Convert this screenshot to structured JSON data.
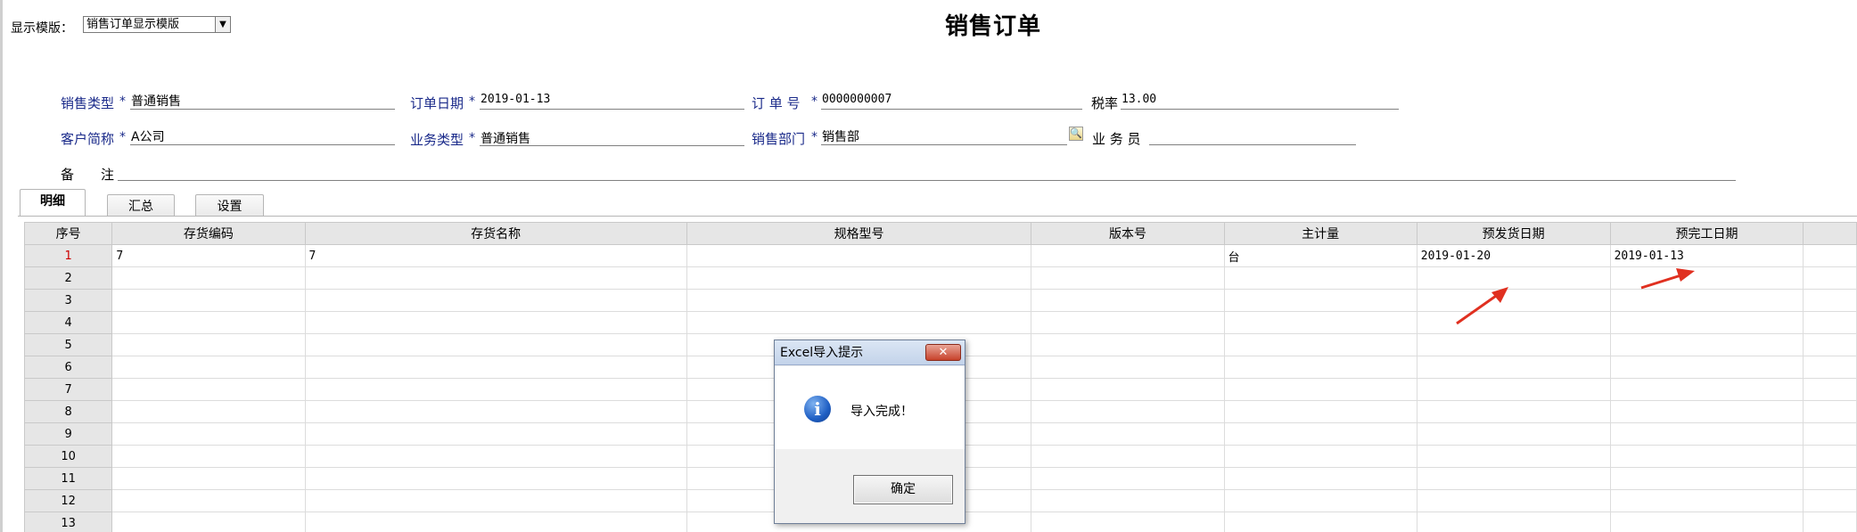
{
  "template": {
    "label": "显示模版：",
    "selected": "销售订单显示模版"
  },
  "title": "销售订单",
  "fields": {
    "sale_type": {
      "label": "销售类型",
      "req": "*",
      "value": "普通销售"
    },
    "order_date": {
      "label": "订单日期",
      "req": "*",
      "value": "2019-01-13"
    },
    "order_no": {
      "label": "订 单 号",
      "req": "*",
      "value": "0000000007"
    },
    "tax_rate": {
      "label": "税率",
      "value": "13.00"
    },
    "customer": {
      "label": "客户简称",
      "req": "*",
      "value": "A公司"
    },
    "biz_type": {
      "label": "业务类型",
      "req": "*",
      "value": "普通销售"
    },
    "dept": {
      "label": "销售部门",
      "req": "*",
      "value": "销售部"
    },
    "salesman": {
      "label": "业 务 员",
      "value": ""
    },
    "remark": {
      "label": "备　　注",
      "value": ""
    }
  },
  "tabs": [
    "明细",
    "汇总",
    "设置"
  ],
  "grid": {
    "columns": [
      "序号",
      "存货编码",
      "存货名称",
      "规格型号",
      "版本号",
      "主计量",
      "预发货日期",
      "预完工日期"
    ],
    "rows": [
      {
        "n": "1",
        "cells": [
          "7",
          "7",
          "",
          "",
          "台",
          "2019-01-20",
          "2019-01-13"
        ]
      },
      {
        "n": "2",
        "cells": [
          "",
          "",
          "",
          "",
          "",
          "",
          ""
        ]
      },
      {
        "n": "3",
        "cells": [
          "",
          "",
          "",
          "",
          "",
          "",
          ""
        ]
      },
      {
        "n": "4",
        "cells": [
          "",
          "",
          "",
          "",
          "",
          "",
          ""
        ]
      },
      {
        "n": "5",
        "cells": [
          "",
          "",
          "",
          "",
          "",
          "",
          ""
        ]
      },
      {
        "n": "6",
        "cells": [
          "",
          "",
          "",
          "",
          "",
          "",
          ""
        ]
      },
      {
        "n": "7",
        "cells": [
          "",
          "",
          "",
          "",
          "",
          "",
          ""
        ]
      },
      {
        "n": "8",
        "cells": [
          "",
          "",
          "",
          "",
          "",
          "",
          ""
        ]
      },
      {
        "n": "9",
        "cells": [
          "",
          "",
          "",
          "",
          "",
          "",
          ""
        ]
      },
      {
        "n": "10",
        "cells": [
          "",
          "",
          "",
          "",
          "",
          "",
          ""
        ]
      },
      {
        "n": "11",
        "cells": [
          "",
          "",
          "",
          "",
          "",
          "",
          ""
        ]
      },
      {
        "n": "12",
        "cells": [
          "",
          "",
          "",
          "",
          "",
          "",
          ""
        ]
      },
      {
        "n": "13",
        "cells": [
          "",
          "",
          "",
          "",
          "",
          "",
          ""
        ]
      }
    ]
  },
  "dialog": {
    "title": "Excel导入提示",
    "close": "✕",
    "icon": "info-icon",
    "message": "导入完成！",
    "ok": "确定"
  },
  "colors": {
    "label": "#1a2a8a",
    "current_row": "#cc0000",
    "arrow": "#e03020"
  }
}
